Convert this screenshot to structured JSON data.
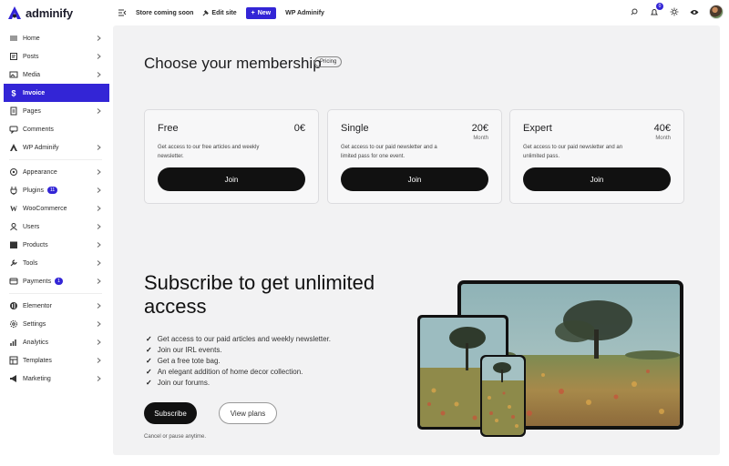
{
  "brand": {
    "name": "adminify",
    "accent": "#3325d6"
  },
  "topbar": {
    "store_label": "Store coming soon",
    "edit_label": "Edit site",
    "new_label": "New",
    "site_label": "WP Adminify",
    "notif_count": "0",
    "icons": [
      "search-icon",
      "bell-icon",
      "sun-icon",
      "eye-icon"
    ]
  },
  "sidebar": {
    "items": [
      {
        "label": "Home",
        "icon": "home-icon"
      },
      {
        "label": "Posts",
        "icon": "pin-icon"
      },
      {
        "label": "Media",
        "icon": "media-icon"
      },
      {
        "label": "Invoice",
        "icon": "dollar-icon",
        "active": true
      },
      {
        "label": "Pages",
        "icon": "page-icon"
      },
      {
        "label": "Comments",
        "icon": "comment-icon"
      },
      {
        "label": "WP Adminify",
        "icon": "adminify-icon"
      },
      {
        "label": "Appearance",
        "icon": "brush-icon"
      },
      {
        "label": "Plugins",
        "icon": "plug-icon",
        "badge": "11"
      },
      {
        "label": "WooCommerce",
        "icon": "woo-icon"
      },
      {
        "label": "Users",
        "icon": "users-icon"
      },
      {
        "label": "Products",
        "icon": "box-icon"
      },
      {
        "label": "Tools",
        "icon": "wrench-icon"
      },
      {
        "label": "Payments",
        "icon": "payment-icon",
        "badge": "1"
      },
      {
        "label": "Elementor",
        "icon": "elementor-icon"
      },
      {
        "label": "Settings",
        "icon": "settings-icon"
      },
      {
        "label": "Analytics",
        "icon": "chart-icon"
      },
      {
        "label": "Templates",
        "icon": "template-icon"
      },
      {
        "label": "Marketing",
        "icon": "megaphone-icon"
      }
    ]
  },
  "membership": {
    "title": "Choose your membership",
    "tag": "Pricing",
    "plans": [
      {
        "name": "Free",
        "price": "0€",
        "period": "",
        "desc": "Get access to our free articles and weekly newsletter.",
        "cta": "Join"
      },
      {
        "name": "Single",
        "price": "20€",
        "period": "Month",
        "desc": "Get access to our paid newsletter and a limited pass for one event.",
        "cta": "Join"
      },
      {
        "name": "Expert",
        "price": "40€",
        "period": "Month",
        "desc": "Get access to our paid newsletter and an unlimited pass.",
        "cta": "Join"
      }
    ]
  },
  "subscribe": {
    "title": "Subscribe to get unlimited access",
    "features": [
      "Get access to our paid articles and weekly newsletter.",
      "Join our IRL events.",
      "Get a free tote bag.",
      "An elegant addition of home decor collection.",
      "Join our forums."
    ],
    "check_mark": "✓",
    "subscribe_label": "Subscribe",
    "view_label": "View plans",
    "note": "Cancel or pause anytime."
  }
}
